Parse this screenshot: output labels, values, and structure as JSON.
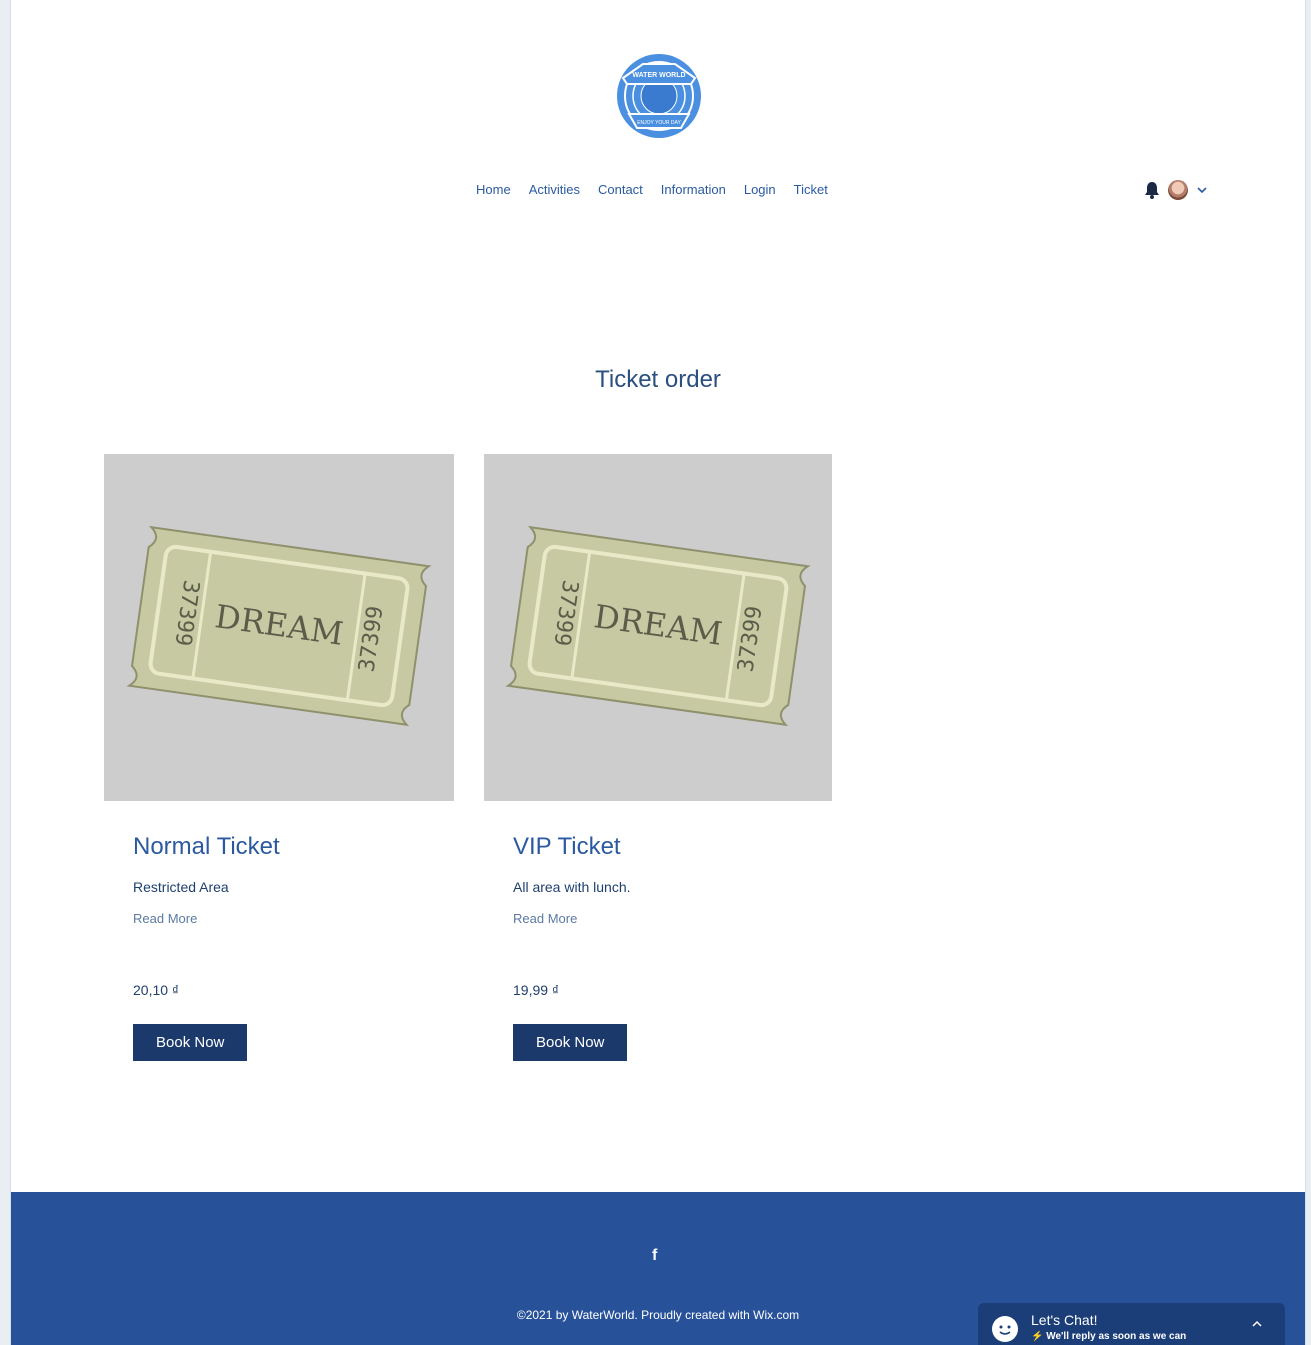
{
  "header": {
    "logo_text_top": "WATER WORLD",
    "logo_text_bottom": "ENJOY YOUR DAY",
    "nav": [
      {
        "label": "Home"
      },
      {
        "label": "Activities"
      },
      {
        "label": "Contact"
      },
      {
        "label": "Information"
      },
      {
        "label": "Login"
      },
      {
        "label": "Ticket"
      }
    ],
    "icons": {
      "notifications": "bell-icon",
      "avatar": "avatar",
      "menu": "chevron-down-icon"
    }
  },
  "main": {
    "title": "Ticket order",
    "products": [
      {
        "image_text": "DREAM",
        "serial": "37399",
        "name": "Normal Ticket",
        "description": "Restricted Area",
        "read_more": "Read More",
        "price": "20,10 ₫",
        "button": "Book Now"
      },
      {
        "image_text": "DREAM",
        "serial": "37399",
        "name": "VIP Ticket",
        "description": "All area with lunch.",
        "read_more": "Read More",
        "price": "19,99 ₫",
        "button": "Book Now"
      }
    ]
  },
  "footer": {
    "social_icon": "facebook-icon",
    "social_label": "f",
    "copyright": "©2021 by WaterWorld. Proudly created with Wix.com",
    "colors": {
      "background": "#27529a"
    }
  },
  "chat": {
    "title": "Let's Chat!",
    "subtitle": "⚡ We'll reply as soon as we can"
  },
  "colors": {
    "accent": "#2b5aa0",
    "button": "#1b3a6b",
    "image_bg": "#cdcdcd"
  }
}
